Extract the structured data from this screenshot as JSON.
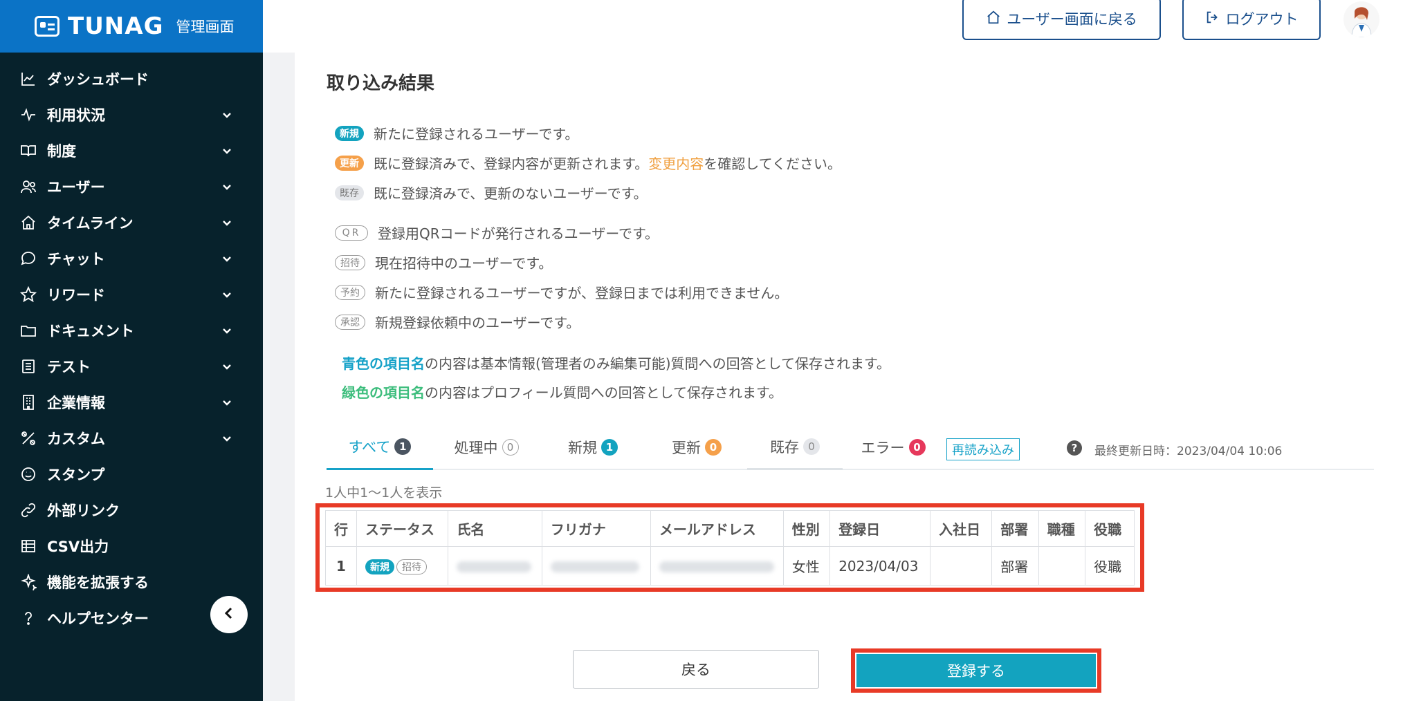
{
  "brand": {
    "name": "TUNAG",
    "subtitle": "管理画面"
  },
  "sidebar": {
    "items": [
      {
        "label": "ダッシュボード",
        "icon": "chart-line-icon",
        "has_children": false
      },
      {
        "label": "利用状況",
        "icon": "pulse-icon",
        "has_children": true
      },
      {
        "label": "制度",
        "icon": "book-icon",
        "has_children": true
      },
      {
        "label": "ユーザー",
        "icon": "users-icon",
        "has_children": true
      },
      {
        "label": "タイムライン",
        "icon": "home-icon",
        "has_children": true
      },
      {
        "label": "チャット",
        "icon": "chat-bubble-icon",
        "has_children": true
      },
      {
        "label": "リワード",
        "icon": "star-icon",
        "has_children": true
      },
      {
        "label": "ドキュメント",
        "icon": "folder-icon",
        "has_children": true
      },
      {
        "label": "テスト",
        "icon": "checklist-icon",
        "has_children": true
      },
      {
        "label": "企業情報",
        "icon": "building-icon",
        "has_children": true
      },
      {
        "label": "カスタム",
        "icon": "tools-icon",
        "has_children": true
      },
      {
        "label": "スタンプ",
        "icon": "smile-icon",
        "has_children": false
      },
      {
        "label": "外部リンク",
        "icon": "link-icon",
        "has_children": false
      },
      {
        "label": "CSV出力",
        "icon": "table-icon",
        "has_children": false
      },
      {
        "label": "機能を拡張する",
        "icon": "sparkle-icon",
        "has_children": false
      },
      {
        "label": "ヘルプセンター",
        "icon": "question-icon",
        "has_children": false
      }
    ]
  },
  "header": {
    "user_screen_button": "ユーザー画面に戻る",
    "logout_button": "ログアウト"
  },
  "main": {
    "title": "取り込み結果",
    "legend": {
      "new": {
        "tag": "新規",
        "text": "新たに登録されるユーザーです。"
      },
      "update": {
        "tag": "更新",
        "text_before": "既に登録済みで、登録内容が更新されます。",
        "highlight": "変更内容",
        "text_after": "を確認してください。"
      },
      "existing": {
        "tag": "既存",
        "text": "既に登録済みで、更新のないユーザーです。"
      },
      "qr": {
        "tag": "QR",
        "text": "登録用QRコードが発行されるユーザーです。"
      },
      "invite": {
        "tag": "招待",
        "text": "現在招待中のユーザーです。"
      },
      "reserve": {
        "tag": "予約",
        "text": "新たに登録されるユーザーですが、登録日までは利用できません。"
      },
      "approve": {
        "tag": "承認",
        "text": "新規登録依頼中のユーザーです。"
      }
    },
    "notes": {
      "blue_label": "青色の項目名",
      "blue_text": "の内容は基本情報(管理者のみ編集可能)質問への回答として保存されます。",
      "green_label": "緑色の項目名",
      "green_text": "の内容はプロフィール質問への回答として保存されます。"
    },
    "tabs": [
      {
        "label": "すべて",
        "count": "1"
      },
      {
        "label": "処理中",
        "count": "0"
      },
      {
        "label": "新規",
        "count": "1"
      },
      {
        "label": "更新",
        "count": "0"
      },
      {
        "label": "既存",
        "count": "0"
      },
      {
        "label": "エラー",
        "count": "0"
      }
    ],
    "reload_button": "再読み込み",
    "last_updated": "最終更新日時：2023/04/04 10:06",
    "showing": "1人中1〜1人を表示",
    "table": {
      "headers": [
        "行",
        "ステータス",
        "氏名",
        "フリガナ",
        "メールアドレス",
        "性別",
        "登録日",
        "入社日",
        "部署",
        "職種",
        "役職"
      ],
      "row": {
        "index": "1",
        "status_tags": [
          "新規",
          "招待"
        ],
        "gender": "女性",
        "registered": "2023/04/03",
        "joined": "",
        "department": "部署",
        "job_type": "",
        "position": "役職"
      }
    },
    "back_button": "戻る",
    "register_button": "登録する"
  },
  "colors": {
    "sidebar_bg": "#07222c",
    "brand_bg": "#0b73c6",
    "accent_teal": "#13a3bf",
    "update_orange": "#f5a04a",
    "error_red": "#e6385b",
    "highlight_frame": "#e83a26"
  }
}
